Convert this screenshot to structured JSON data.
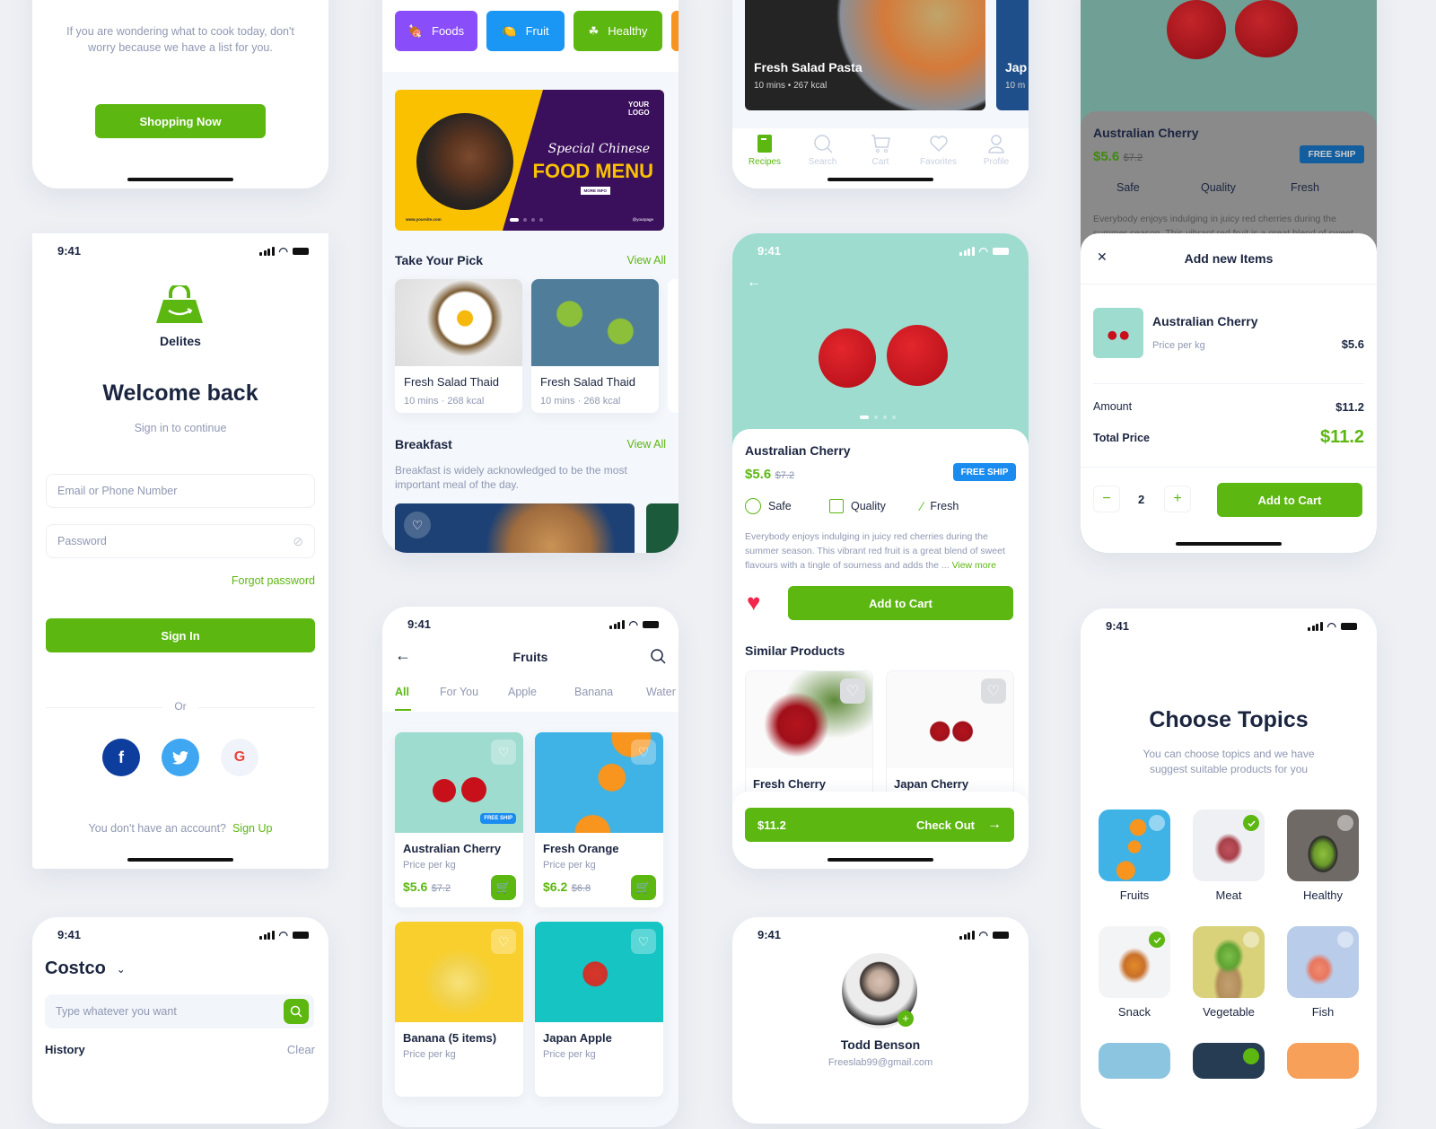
{
  "onboarding": {
    "description": "If you are wondering what to cook today, don't worry because we have a list for you.",
    "cta": "Shopping Now"
  },
  "login": {
    "time": "9:41",
    "brand": "Delites",
    "title": "Welcome back",
    "subtitle": "Sign in to continue",
    "email_placeholder": "Email or Phone Number",
    "password_placeholder": "Password",
    "forgot": "Forgot password",
    "signin": "Sign In",
    "or": "Or",
    "no_account": "You don't have an account?",
    "signup": "Sign Up",
    "social": [
      "facebook",
      "twitter",
      "google"
    ]
  },
  "search_screen": {
    "time": "9:41",
    "store": "Costco",
    "placeholder": "Type whatever you want",
    "history": "History",
    "clear": "Clear"
  },
  "home": {
    "categories": [
      {
        "label": "Foods",
        "icon": "meat-icon",
        "color": "#8a4dfa"
      },
      {
        "label": "Fruit",
        "icon": "lemon-icon",
        "color": "#1a96f5"
      },
      {
        "label": "Healthy",
        "icon": "clover-icon",
        "color": "#5cb711"
      }
    ],
    "banner": {
      "logo": "YOUR LOGO",
      "script": "Special Chinese",
      "headline": "FOOD MENU",
      "more": "MORE INFO",
      "site": "www.yoursite.com",
      "social": "@yourpage"
    },
    "take_your_pick": {
      "title": "Take Your Pick",
      "view_all": "View All",
      "items": [
        {
          "name": "Fresh Salad Thaid",
          "time": "10 mins",
          "kcal": "268 kcal"
        },
        {
          "name": "Fresh Salad Thaid",
          "time": "10 mins",
          "kcal": "268 kcal"
        }
      ]
    },
    "breakfast": {
      "title": "Breakfast",
      "view_all": "View All",
      "description": "Breakfast is widely acknowledged to be the most important meal of the day."
    }
  },
  "fruits": {
    "time": "9:41",
    "title": "Fruits",
    "tabs": [
      "All",
      "For You",
      "Apple",
      "Banana",
      "Water"
    ],
    "active_tab": "All",
    "products": [
      {
        "name": "Australian Cherry",
        "unit": "Price per kg",
        "price": "$5.6",
        "old": "$7.2",
        "badge": "FREE SHIP",
        "bg": "#9fdcd0"
      },
      {
        "name": "Fresh Orange",
        "unit": "Price per kg",
        "price": "$6.2",
        "old": "$6.8",
        "bg": "#3fb2e6"
      },
      {
        "name": "Banana (5 items)",
        "unit": "Price per kg",
        "bg": "#f8cf2c"
      },
      {
        "name": "Japan Apple",
        "unit": "Price per kg",
        "bg": "#16c4c4"
      }
    ]
  },
  "recipes": {
    "featured": [
      {
        "name": "Fresh Salad Pasta",
        "time": "10 mins",
        "kcal": "267 kcal"
      },
      {
        "name": "Jap",
        "time": "10 m"
      }
    ],
    "tabbar": [
      {
        "label": "Recipes",
        "icon": "book-icon",
        "active": true
      },
      {
        "label": "Search",
        "icon": "search-icon",
        "active": false
      },
      {
        "label": "Cart",
        "icon": "cart-icon",
        "active": false
      },
      {
        "label": "Favorites",
        "icon": "heart-icon",
        "active": false
      },
      {
        "label": "Profile",
        "icon": "user-icon",
        "active": false
      }
    ]
  },
  "detail": {
    "time": "9:41",
    "name": "Australian Cherry",
    "price": "$5.6",
    "old_price": "$7.2",
    "badge": "FREE SHIP",
    "features": [
      "Safe",
      "Quality",
      "Fresh"
    ],
    "description": "Everybody enjoys indulging in juicy red cherries during the summer season. This vibrant red fruit is a great blend of sweet flavours with a tingle of sourness and adds the ...",
    "view_more": "View more",
    "add_to_cart": "Add to Cart",
    "similar_title": "Similar Products",
    "similar": [
      "Fresh Cherry",
      "Japan Cherry"
    ],
    "checkout_total": "$11.2",
    "checkout": "Check Out"
  },
  "profile": {
    "time": "9:41",
    "name": "Todd Benson",
    "email": "Freeslab99@gmail.com"
  },
  "add_items": {
    "bg_name": "Australian Cherry",
    "bg_price": "$5.6",
    "bg_old": "$7.2",
    "bg_badge": "FREE SHIP",
    "bg_features": [
      "Safe",
      "Quality",
      "Fresh"
    ],
    "bg_desc": "Everybody enjoys indulging in juicy red cherries during the summer season. This vibrant red fruit is a great blend of sweet",
    "title": "Add new Items",
    "item_name": "Australian Cherry",
    "item_unit": "Price per kg",
    "item_price": "$5.6",
    "amount_label": "Amount",
    "amount": "$11.2",
    "total_label": "Total Price",
    "total": "$11.2",
    "quantity": "2",
    "add_to_cart": "Add to Cart"
  },
  "topics": {
    "time": "9:41",
    "title": "Choose Topics",
    "subtitle": "You can choose topics and we have suggest suitable products for you",
    "items": [
      {
        "label": "Fruits",
        "selected": false,
        "bg": "#3fb2e6"
      },
      {
        "label": "Meat",
        "selected": true,
        "bg": "#eef0f3"
      },
      {
        "label": "Healthy",
        "selected": false,
        "bg": "#6f6a66"
      },
      {
        "label": "Snack",
        "selected": true,
        "bg": "#f3f4f6"
      },
      {
        "label": "Vegetable",
        "selected": false,
        "bg": "#d9d27a"
      },
      {
        "label": "Fish",
        "selected": false,
        "bg": "#b9cdea"
      }
    ]
  }
}
